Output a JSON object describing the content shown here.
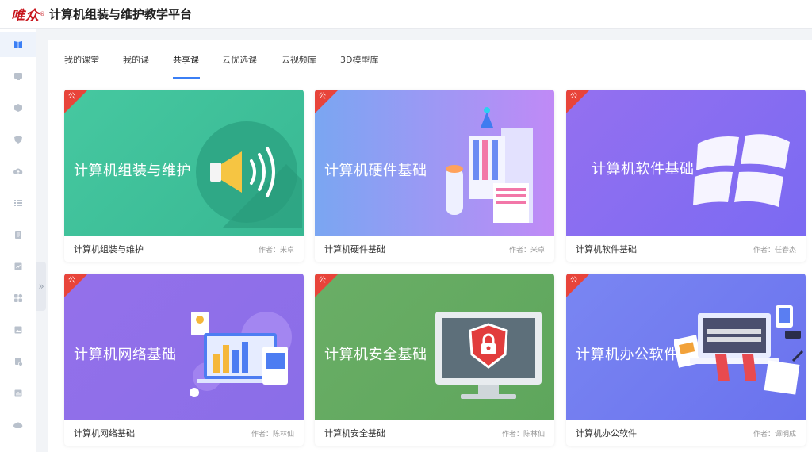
{
  "header": {
    "logo_text": "唯众",
    "logo_reg": "®",
    "title": "计算机组装与维护教学平台"
  },
  "sidebar": {
    "items": [
      {
        "icon": "book-icon",
        "active": true
      },
      {
        "icon": "monitor-icon"
      },
      {
        "icon": "cube-icon"
      },
      {
        "icon": "shield-icon"
      },
      {
        "icon": "cloud-upload-icon"
      },
      {
        "icon": "list-icon"
      },
      {
        "icon": "document-icon"
      },
      {
        "icon": "report-icon"
      },
      {
        "icon": "apps-icon"
      },
      {
        "icon": "image-icon"
      },
      {
        "icon": "file-check-icon"
      },
      {
        "icon": "chart-icon"
      },
      {
        "icon": "cloud-download-icon"
      }
    ],
    "collapse_glyph": "»"
  },
  "tabs": [
    "我的课堂",
    "我的课",
    "共享课",
    "云优选课",
    "云视频库",
    "3D模型库"
  ],
  "active_tab": "共享课",
  "courses": [
    {
      "badge": "公",
      "cover_title": "计算机组装与维护",
      "name": "计算机组装与维护",
      "author": "作者：米卓",
      "color": "#3ec39b"
    },
    {
      "badge": "公",
      "cover_title": "计算机硬件基础",
      "name": "计算机硬件基础",
      "author": "作者：米卓",
      "color": "#8aa2f0"
    },
    {
      "badge": "公",
      "cover_title": "计算机软件基础",
      "name": "计算机软件基础",
      "author": "作者：任春杰",
      "color": "#8e70ef"
    },
    {
      "badge": "公",
      "cover_title": "计算机网络基础",
      "name": "计算机网络基础",
      "author": "作者：陈林仙",
      "color": "#8f6fe8"
    },
    {
      "badge": "公",
      "cover_title": "计算机安全基础",
      "name": "计算机安全基础",
      "author": "作者：陈林仙",
      "color": "#64aa63"
    },
    {
      "badge": "公",
      "cover_title": "计算机办公软件",
      "name": "计算机办公软件",
      "author": "作者：谭明成",
      "color": "#6f7cf0"
    }
  ]
}
